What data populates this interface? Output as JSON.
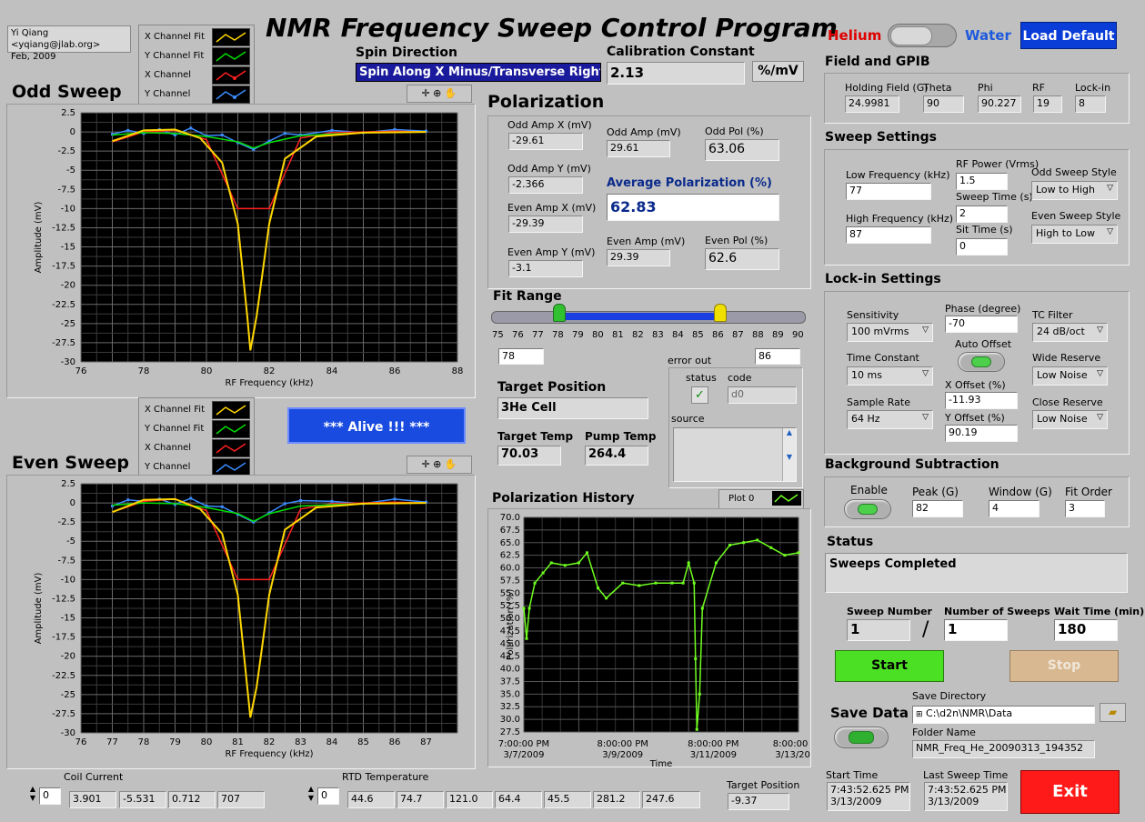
{
  "app": {
    "title": "NMR Frequency Sweep Control Program",
    "author": "Yi Qiang <yqiang@jlab.org>",
    "date": "Feb, 2009"
  },
  "mode": {
    "left": "Helium",
    "right": "Water",
    "left_color": "#e00000",
    "right_color": "#1e5adc"
  },
  "load_default": "Load Default",
  "spin": {
    "label": "Spin Direction",
    "value": "Spin Along X Minus/Transverse Right"
  },
  "calibration": {
    "label": "Calibration Constant",
    "value": "2.13",
    "unit": "%/mV"
  },
  "legend": [
    "X Channel Fit",
    "Y Channel Fit",
    "X Channel",
    "Y Channel"
  ],
  "series_colors": {
    "x_fit": "#ffd700",
    "y_fit": "#00e000",
    "x": "#ff2020",
    "y": "#3c8cff"
  },
  "odd_sweep": {
    "title": "Odd Sweep",
    "xlabel": "RF Frequency (kHz)",
    "ylabel": "Amplitude (mV)",
    "xticks": [
      "76",
      "78",
      "80",
      "82",
      "84",
      "86",
      "88"
    ],
    "yticks": [
      "2.5",
      "0",
      "-2.5",
      "-5",
      "-7.5",
      "-10",
      "-12.5",
      "-15",
      "-17.5",
      "-20",
      "-22.5",
      "-25",
      "-27.5",
      "-30"
    ]
  },
  "even_sweep": {
    "title": "Even Sweep",
    "xlabel": "RF Frequency (kHz)",
    "ylabel": "Amplitude (mV)",
    "xticks": [
      "76",
      "77",
      "78",
      "79",
      "80",
      "81",
      "82",
      "83",
      "84",
      "85",
      "86",
      "87"
    ],
    "yticks": [
      "2.5",
      "0",
      "-2.5",
      "-5",
      "-7.5",
      "-10",
      "-12.5",
      "-15",
      "-17.5",
      "-20",
      "-22.5",
      "-25",
      "-27.5",
      "-30"
    ]
  },
  "chart_data": [
    {
      "type": "line",
      "xlabel": "RF Frequency (kHz)",
      "ylabel": "Amplitude (mV)",
      "xlim": [
        76,
        88
      ],
      "ylim": [
        -30,
        2.5
      ],
      "series": [
        {
          "name": "X Channel Fit",
          "x": [
            77,
            78,
            79,
            79.8,
            80.5,
            81,
            81.3,
            81.4,
            81.6,
            82,
            82.5,
            83.5,
            85,
            87
          ],
          "y": [
            -1.2,
            0.2,
            0.3,
            -0.8,
            -4,
            -12,
            -24,
            -28.5,
            -24,
            -12,
            -3.5,
            -0.6,
            -0.1,
            0
          ]
        },
        {
          "name": "Y Channel Fit",
          "x": [
            77,
            78,
            79,
            80,
            81,
            81.5,
            82,
            83,
            85,
            87
          ],
          "y": [
            -0.4,
            -0.1,
            -0.2,
            -0.6,
            -1.3,
            -2.1,
            -1.4,
            -0.5,
            -0.1,
            0
          ]
        },
        {
          "name": "X Channel",
          "x": [
            77,
            78,
            79,
            80,
            81,
            82,
            83,
            84,
            85,
            86,
            87
          ],
          "y": [
            -1.3,
            0,
            0.2,
            -1,
            -10,
            -10,
            -0.8,
            -0.1,
            0,
            0.1,
            0
          ]
        },
        {
          "name": "Y Channel",
          "x": [
            77,
            77.5,
            78,
            78.5,
            79,
            79.5,
            80,
            80.5,
            81,
            81.5,
            82,
            82.5,
            83,
            84,
            85,
            86,
            87
          ],
          "y": [
            -0.3,
            0.2,
            -0.2,
            0.3,
            -0.4,
            0.5,
            -0.5,
            -0.4,
            -1.4,
            -2.3,
            -1.2,
            -0.2,
            -0.4,
            0.2,
            -0.1,
            0.3,
            0.1
          ]
        }
      ]
    },
    {
      "type": "line",
      "xlabel": "RF Frequency (kHz)",
      "ylabel": "Amplitude (mV)",
      "xlim": [
        76,
        88
      ],
      "ylim": [
        -30,
        2.5
      ],
      "series": [
        {
          "name": "X Channel Fit",
          "x": [
            77,
            78,
            79,
            79.8,
            80.5,
            81,
            81.3,
            81.4,
            81.6,
            82,
            82.5,
            83.5,
            85,
            87
          ],
          "y": [
            -1.2,
            0.4,
            0.5,
            -0.8,
            -4,
            -12,
            -24,
            -28,
            -24,
            -12,
            -3.5,
            -0.6,
            -0.1,
            0
          ]
        },
        {
          "name": "Y Channel Fit",
          "x": [
            77,
            78,
            79,
            80,
            81,
            81.5,
            82,
            83,
            85,
            87
          ],
          "y": [
            -0.3,
            0,
            -0.1,
            -0.6,
            -1.4,
            -2.4,
            -1.4,
            -0.4,
            -0.1,
            0
          ]
        },
        {
          "name": "X Channel",
          "x": [
            77,
            78,
            79,
            80,
            81,
            82,
            83,
            84,
            85,
            86,
            87
          ],
          "y": [
            -1.2,
            0.2,
            0.5,
            -1,
            -10,
            -10,
            -0.8,
            -0.1,
            0,
            0.1,
            0
          ]
        },
        {
          "name": "Y Channel",
          "x": [
            77,
            77.5,
            78,
            78.5,
            79,
            79.5,
            80,
            80.5,
            81,
            81.5,
            82,
            82.5,
            83,
            84,
            85,
            86,
            87
          ],
          "y": [
            -0.4,
            0.4,
            0.2,
            0.5,
            -0.2,
            0.6,
            -0.4,
            -0.5,
            -1.5,
            -2.5,
            -1.3,
            -0.1,
            0.3,
            0.2,
            -0.1,
            0.5,
            0.1
          ]
        }
      ]
    },
    {
      "type": "line",
      "xlabel": "Time",
      "ylabel": "Polarization (%)",
      "ylim": [
        27.5,
        70
      ],
      "xticks": [
        [
          "7:00:00 PM",
          "3/7/2009"
        ],
        [
          "8:00:00 PM",
          "3/9/2009"
        ],
        [
          "8:00:00 PM",
          "3/11/2009"
        ],
        [
          "8:00:00 PM",
          "3/13/2009"
        ]
      ],
      "series": [
        {
          "name": "Plot 0",
          "x": [
            0,
            0.01,
            0.02,
            0.04,
            0.07,
            0.1,
            0.15,
            0.2,
            0.23,
            0.27,
            0.3,
            0.36,
            0.42,
            0.48,
            0.54,
            0.58,
            0.6,
            0.62,
            0.625,
            0.63,
            0.64,
            0.65,
            0.7,
            0.75,
            0.8,
            0.85,
            0.9,
            0.95,
            1
          ],
          "y": [
            52,
            46,
            52,
            57,
            59,
            61,
            60.5,
            61,
            63,
            56,
            54,
            57,
            56.5,
            57,
            57,
            57,
            61,
            57,
            42,
            28,
            35,
            52,
            61,
            64.5,
            65,
            65.5,
            64,
            62.5,
            63
          ]
        }
      ]
    }
  ],
  "alive": "*** Alive !!! ***",
  "polarization": {
    "title": "Polarization",
    "odd_amp_x": {
      "label": "Odd Amp X (mV)",
      "value": "-29.61"
    },
    "odd_amp_y": {
      "label": "Odd Amp Y (mV)",
      "value": "-2.366"
    },
    "even_amp_x": {
      "label": "Even Amp X (mV)",
      "value": "-29.39"
    },
    "even_amp_y": {
      "label": "Even Amp Y (mV)",
      "value": "-3.1"
    },
    "odd_amp": {
      "label": "Odd Amp (mV)",
      "value": "29.61"
    },
    "odd_pol": {
      "label": "Odd Pol (%)",
      "value": "63.06"
    },
    "avg_pol": {
      "label": "Average Polarization (%)",
      "value": "62.83"
    },
    "even_amp": {
      "label": "Even Amp (mV)",
      "value": "29.39"
    },
    "even_pol": {
      "label": "Even Pol (%)",
      "value": "62.6"
    }
  },
  "fit_range": {
    "label": "Fit Range",
    "ticks": [
      "75",
      "76",
      "77",
      "78",
      "79",
      "80",
      "81",
      "82",
      "83",
      "84",
      "85",
      "86",
      "87",
      "88",
      "89",
      "90"
    ],
    "min": 75,
    "max": 90,
    "low": "78",
    "high": "86"
  },
  "target": {
    "pos_label": "Target Position",
    "pos_value": "3He Cell",
    "temp_label": "Target Temp",
    "temp_value": "70.03",
    "pump_label": "Pump Temp",
    "pump_value": "264.4"
  },
  "error_out": {
    "label": "error out",
    "status": "status",
    "code": "code",
    "code_value": "d0",
    "source": "source",
    "check": "✓"
  },
  "history": {
    "title": "Polarization History",
    "plot_label": "Plot 0",
    "xlabel": "Time",
    "ylabel": "Polarization (%)",
    "yticks": [
      "70.0",
      "67.5",
      "65.0",
      "62.5",
      "60.0",
      "57.5",
      "55.0",
      "52.5",
      "50.0",
      "47.5",
      "45.0",
      "42.5",
      "40.0",
      "37.5",
      "35.0",
      "32.5",
      "30.0",
      "27.5"
    ]
  },
  "field_gpib": {
    "title": "Field and GPIB",
    "items": [
      {
        "label": "Holding Field (G)",
        "value": "24.9981"
      },
      {
        "label": "Theta",
        "value": "90"
      },
      {
        "label": "Phi",
        "value": "90.227"
      },
      {
        "label": "RF",
        "value": "19"
      },
      {
        "label": "Lock-in",
        "value": "8"
      }
    ]
  },
  "sweep_settings": {
    "title": "Sweep Settings",
    "low_freq": {
      "label": "Low Frequency (kHz)",
      "value": "77"
    },
    "high_freq": {
      "label": "High Frequency (kHz)",
      "value": "87"
    },
    "rf_power": {
      "label": "RF Power (Vrms)",
      "value": "1.5"
    },
    "sweep_time": {
      "label": "Sweep Time (s)",
      "value": "2"
    },
    "sit_time": {
      "label": "Sit Time (s)",
      "value": "0"
    },
    "odd_style": {
      "label": "Odd Sweep Style",
      "value": "Low to High"
    },
    "even_style": {
      "label": "Even Sweep Style",
      "value": "High to Low"
    }
  },
  "lockin": {
    "title": "Lock-in Settings",
    "sensitivity": {
      "label": "Sensitivity",
      "value": "100 mVrms"
    },
    "time_constant": {
      "label": "Time Constant",
      "value": "10 ms"
    },
    "sample_rate": {
      "label": "Sample Rate",
      "value": "64 Hz"
    },
    "phase": {
      "label": "Phase (degree)",
      "value": "-70"
    },
    "auto_offset": "Auto Offset",
    "x_offset": {
      "label": "X Offset (%)",
      "value": "-11.93"
    },
    "y_offset": {
      "label": "Y Offset (%)",
      "value": "90.19"
    },
    "tc_filter": {
      "label": "TC Filter",
      "value": "24 dB/oct"
    },
    "wide_reserve": {
      "label": "Wide Reserve",
      "value": "Low Noise"
    },
    "close_reserve": {
      "label": "Close Reserve",
      "value": "Low Noise"
    }
  },
  "background": {
    "title": "Background Subtraction",
    "enable": "Enable",
    "peak": {
      "label": "Peak (G)",
      "value": "82"
    },
    "window": {
      "label": "Window (G)",
      "value": "4"
    },
    "fit_order": {
      "label": "Fit Order",
      "value": "3"
    }
  },
  "status": {
    "title": "Status",
    "value": "Sweeps Completed"
  },
  "sweep_counter": {
    "number_label": "Sweep Number",
    "number_value": "1",
    "slash": "/",
    "count_label": "Number of Sweeps",
    "count_value": "1",
    "wait_label": "Wait Time (min)",
    "wait_value": "180"
  },
  "start": "Start",
  "stop": "Stop",
  "save": {
    "label": "Save Data",
    "dir_label": "Save Directory",
    "dir_value": "C:\\d2n\\NMR\\Data",
    "folder_label": "Folder Name",
    "folder_value": "NMR_Freq_He_20090313_194352"
  },
  "times": {
    "start_label": "Start Time",
    "start_time": "7:43:52.625 PM",
    "start_date": "3/13/2009",
    "last_label": "Last Sweep Time",
    "last_time": "7:43:52.625 PM",
    "last_date": "3/13/2009"
  },
  "exit": "Exit",
  "coil": {
    "label": "Coil Current",
    "index": "0",
    "values": [
      "3.901",
      "-5.531",
      "0.712",
      "707"
    ]
  },
  "rtd": {
    "label": "RTD Temperature",
    "index": "0",
    "values": [
      "44.6",
      "74.7",
      "121.0",
      "64.4",
      "45.5",
      "281.2",
      "247.6"
    ]
  },
  "target_position": {
    "label": "Target Position",
    "value": "-9.37"
  }
}
